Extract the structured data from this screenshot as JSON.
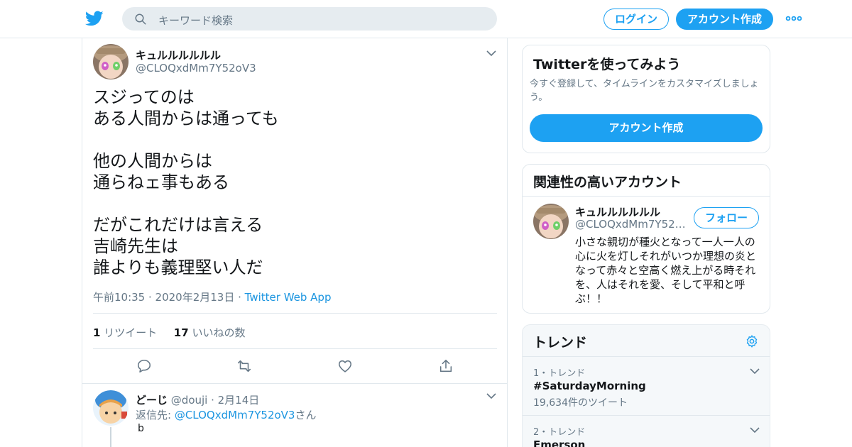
{
  "topbar": {
    "search_placeholder": "キーワード検索",
    "login_label": "ログイン",
    "signup_label": "アカウント作成"
  },
  "tweet": {
    "name": "キュルルルルルル",
    "handle": "@CLOQxdMm7Y52oV3",
    "paragraphs": [
      [
        "スジってのは",
        "ある人間からは通っても"
      ],
      [
        "他の人間からは",
        "通らねェ事もある"
      ],
      [
        "だがこれだけは言える",
        "吉崎先生は",
        "誰よりも義理堅い人だ"
      ]
    ],
    "timestamp": "午前10:35 · 2020年2月13日 ·",
    "source": "Twitter Web App",
    "retweets_count": "1",
    "retweets_label": "リツイート",
    "likes_count": "17",
    "likes_label": "いいねの数"
  },
  "reply": {
    "name": "どーじ",
    "handle_date": "@douji · 2月14日",
    "reply_to_prefix": "返信先: ",
    "reply_to_user": "@CLOQxdMm7Y52oV3",
    "reply_to_suffix": "さん",
    "text": "b"
  },
  "signup_card": {
    "title": "Twitterを使ってみよう",
    "description": "今すぐ登録して、タイムラインをカスタマイズしましょう。",
    "button": "アカウント作成"
  },
  "related_card": {
    "title": "関連性の高いアカウント",
    "name": "キュルルルルルル",
    "handle": "@CLOQxdMm7Y52oV3",
    "follow": "フォロー",
    "bio": "小さな親切が種火となって一人一人の心に火を灯しそれがいつか理想の炎となって赤々と空高く燃え上がる時それを、人はそれを愛、そして平和と呼ぶ！！"
  },
  "trends_card": {
    "title": "トレンド",
    "items": [
      {
        "meta": "1・トレンド",
        "tag": "#SaturdayMorning",
        "count": "19,634件のツイート"
      },
      {
        "meta": "2・トレンド",
        "tag": "Emerson",
        "count": ""
      }
    ]
  },
  "colors": {
    "accent": "#1da1f2",
    "link": "#1b95e0",
    "muted": "#657786",
    "border": "#e1e8ed"
  },
  "icons": [
    "twitter-bird-icon",
    "search-icon",
    "more-dots-icon",
    "chevron-down-icon",
    "reply-icon",
    "retweet-icon",
    "like-icon",
    "share-icon",
    "gear-icon"
  ]
}
